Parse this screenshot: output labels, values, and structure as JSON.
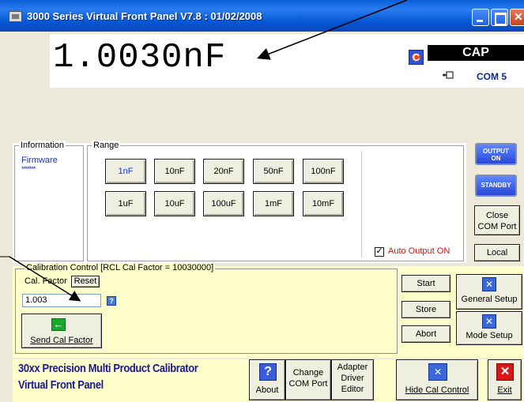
{
  "window": {
    "title": "3000 Series Virtual Front Panel V7.8 : 01/02/2008"
  },
  "display": {
    "reading": "1.0030nF",
    "mode": "CAP",
    "com_port": "COM 5",
    "mode_icon_letter": "C"
  },
  "information": {
    "legend": "Information",
    "firmware_label": "Firmware",
    "firmware_value": "*******"
  },
  "range": {
    "legend": "Range",
    "row1": [
      "1nF",
      "10nF",
      "20nF",
      "50nF",
      "100nF"
    ],
    "row2": [
      "1uF",
      "10uF",
      "100uF",
      "1mF",
      "10mF"
    ],
    "selected": "1nF"
  },
  "auto_output": {
    "label": "Auto Output ON",
    "checked": true
  },
  "side_buttons": {
    "output_on_line1": "OUTPUT",
    "output_on_line2": "ON",
    "standby": "STANDBY",
    "close_com_line1": "Close",
    "close_com_line2": "COM Port",
    "local": "Local"
  },
  "calibration": {
    "legend": "Calibration Control [RCL Cal Factor = 10030000]",
    "cal_factor_label": "Cal. Factor",
    "reset_label": "Reset",
    "cal_factor_value": "1.003",
    "send_label": "Send Cal Factor",
    "start_label": "Start",
    "store_label": "Store",
    "abort_label": "Abort",
    "general_setup_label": "General Setup",
    "mode_setup_label": "Mode Setup"
  },
  "bottom": {
    "brand_line1": "30xx Precision Multi Product Calibrator",
    "brand_line2": "Virtual Front Panel",
    "about_label": "About",
    "change_com_line1": "Change",
    "change_com_line2": "COM Port",
    "adapter_line1": "Adapter",
    "adapter_line2": "Driver",
    "adapter_line3": "Editor",
    "hide_cal_label": "Hide Cal Control",
    "exit_label": "Exit"
  },
  "colors": {
    "titlebar": "#0a5fd8",
    "panel_background": "#ece9d8",
    "cal_background": "#ffffcc",
    "brand_text": "#1a1890",
    "auto_output_text": "#c01818",
    "firmware_text": "#1432b0"
  },
  "icons": {
    "app": "app-icon",
    "mode": "capacitance-mode-icon",
    "plug": "plug-icon",
    "help": "help-icon",
    "send": "green-arrow-icon",
    "tools": "tools-icon",
    "exit": "exit-icon"
  }
}
